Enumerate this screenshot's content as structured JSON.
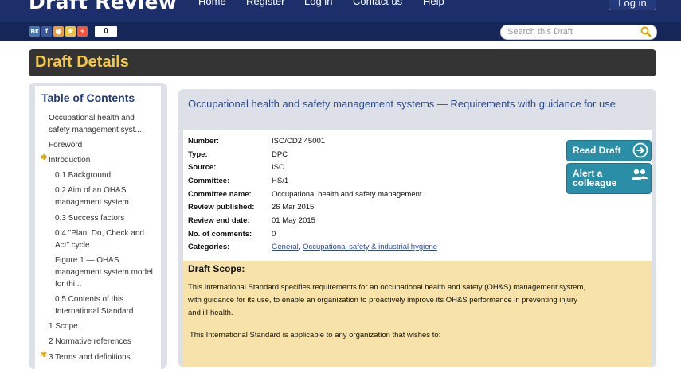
{
  "header": {
    "brand": "Draft Review",
    "nav": [
      "Home",
      "Register",
      "Log in",
      "Contact us",
      "Help"
    ],
    "login_button": "Log in"
  },
  "share": {
    "icons": [
      "vk-icon",
      "facebook-icon",
      "odnoklassniki-icon",
      "favorites-icon",
      "addthis-icon"
    ],
    "count": "0"
  },
  "search": {
    "placeholder": "Search this Draft"
  },
  "page_title": "Draft Details",
  "toc": {
    "title": "Table of Contents",
    "items": [
      "Occupational health and",
      "safety management syst...",
      "Foreword",
      "Introduction",
      "0.1 Background",
      "0.2 Aim of an OH&S",
      "management system",
      "0.3 Success factors",
      "0.4 \"Plan, Do, Check and",
      "Act\" cycle",
      "Figure 1 — OH&S",
      "management system model",
      "for thi...",
      "0.5 Contents of this",
      "International Standard",
      "1 Scope",
      "2 Normative references",
      "3 Terms and definitions"
    ]
  },
  "draft": {
    "title": "Occupational health and safety management systems — Requirements with guidance for use",
    "fields": [
      {
        "label": "Number:",
        "value": "ISO/CD2 45001"
      },
      {
        "label": "Type:",
        "value": "DPC"
      },
      {
        "label": "Source:",
        "value": "ISO"
      },
      {
        "label": "Committee:",
        "value": "HS/1"
      },
      {
        "label": "Committee name:",
        "value": "Occupational health and safety management"
      },
      {
        "label": "Review published:",
        "value": "26 Mar 2015"
      },
      {
        "label": "Review end date:",
        "value": "01 May 2015"
      },
      {
        "label": "No. of comments:",
        "value": "0"
      }
    ],
    "categories_label": "Categories:",
    "categories": [
      "General",
      "Occupational safety & industrial hygiene"
    ],
    "categories_sep": ", ",
    "read_draft": "Read Draft",
    "alert_line1": "Alert a",
    "alert_line2": "colleague"
  },
  "scope": {
    "heading": "Draft Scope:",
    "para1_line1": "This International Standard specifies requirements for an occupational health and safety (OH&S) management system,",
    "para1_line2": "with guidance for its use, to enable an organization to proactively improve its OH&S performance in preventing injury",
    "para1_line3": "and ill-health.",
    "para2": "This International Standard is applicable to any organization that wishes to:"
  },
  "colors": {
    "header_bg": "#1c2f6b",
    "title_bar_bg": "#343434",
    "title_text": "#f4c842",
    "link": "#2e4a8f",
    "cta_bg": "#2a8fa6",
    "scope_bg": "#f7e3a9"
  }
}
